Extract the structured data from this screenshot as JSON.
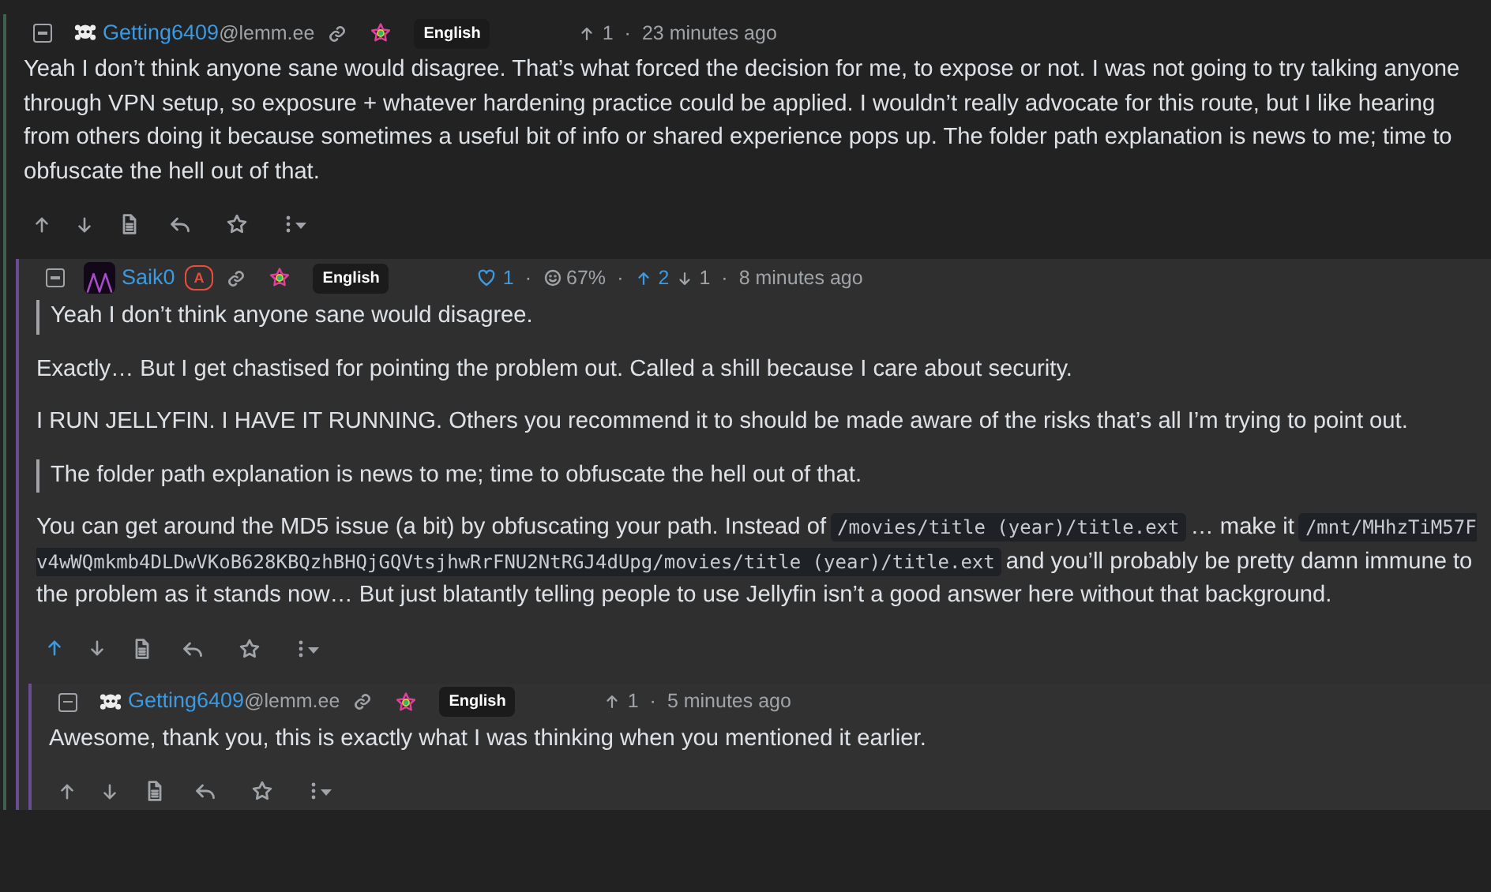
{
  "comments": [
    {
      "author": {
        "name": "Getting6409",
        "instance": "@lemm.ee",
        "avatar": {
          "kind": "skull"
        }
      },
      "language": "English",
      "stats": [
        {
          "kind": "up",
          "text": "1",
          "highlighted": false
        },
        {
          "kind": "dot",
          "text": "·",
          "highlighted": false
        },
        {
          "kind": "time",
          "text": "23 minutes ago",
          "highlighted": false
        }
      ],
      "body": [
        {
          "kind": "paragraph",
          "segments": [
            {
              "kind": "text",
              "text": "Yeah I don’t think anyone sane would disagree. That’s what forced the decision for me, to expose or not. I was not going to try talking anyone through VPN setup, so exposure + whatever hardening practice could be applied. I wouldn’t really advocate for this route, but I like hearing from others doing it because sometimes a useful bit of info or shared experience pops up. The folder path explanation is news to me; time to obfuscate the hell out of that."
            }
          ]
        }
      ],
      "upvoted": false,
      "children": [
        {
          "author": {
            "name": "Saik0",
            "avatar": {
              "kind": "image"
            },
            "admin_badge": "A"
          },
          "language": "English",
          "stats": [
            {
              "kind": "likes",
              "text": "1",
              "highlighted": true
            },
            {
              "kind": "dot",
              "text": "·",
              "highlighted": false
            },
            {
              "kind": "ratio",
              "text": "67%",
              "highlighted": false
            },
            {
              "kind": "dot",
              "text": "·",
              "highlighted": false
            },
            {
              "kind": "up",
              "text": "2",
              "highlighted": true
            },
            {
              "kind": "down",
              "text": "1",
              "highlighted": false
            },
            {
              "kind": "dot",
              "text": "·",
              "highlighted": false
            },
            {
              "kind": "time",
              "text": "8 minutes ago",
              "highlighted": false
            }
          ],
          "body": [
            {
              "kind": "quote",
              "segments": [
                {
                  "kind": "text",
                  "text": "Yeah I don’t think anyone sane would disagree."
                }
              ]
            },
            {
              "kind": "paragraph",
              "segments": [
                {
                  "kind": "text",
                  "text": "Exactly… But I get chastised for pointing the problem out. Called a shill because I care about security."
                }
              ]
            },
            {
              "kind": "paragraph",
              "segments": [
                {
                  "kind": "text",
                  "text": "I RUN JELLYFIN. I HAVE IT RUNNING. Others you recommend it to should be made aware of the risks that’s all I’m trying to point out."
                }
              ]
            },
            {
              "kind": "quote",
              "segments": [
                {
                  "kind": "text",
                  "text": "The folder path explanation is news to me; time to obfuscate the hell out of that."
                }
              ]
            },
            {
              "kind": "paragraph",
              "segments": [
                {
                  "kind": "text",
                  "text": "You can get around the MD5 issue (a bit) by obfuscating your path. Instead of"
                },
                {
                  "kind": "code",
                  "text": "/movies/title (year)/title.ext"
                },
                {
                  "kind": "text",
                  "text": "… make it"
                },
                {
                  "kind": "code",
                  "text": "/mnt/MHhzTiM57Fv4wWQmkmb4DLDwVKoB628KBQzhBHQjGQVtsjhwRrFNU2NtRGJ4dUpg/movies/title (year)/title.ext"
                },
                {
                  "kind": "text",
                  "text": "and you’ll probably be pretty damn immune to the problem as it stands now… But just blatantly telling people to use Jellyfin isn’t a good answer here without that background."
                }
              ]
            }
          ],
          "upvoted": true,
          "children": [
            {
              "author": {
                "name": "Getting6409",
                "instance": "@lemm.ee",
                "avatar": {
                  "kind": "skull"
                }
              },
              "language": "English",
              "stats": [
                {
                  "kind": "up",
                  "text": "1",
                  "highlighted": false
                },
                {
                  "kind": "dot",
                  "text": "·",
                  "highlighted": false
                },
                {
                  "kind": "time",
                  "text": "5 minutes ago",
                  "highlighted": false
                }
              ],
              "body": [
                {
                  "kind": "paragraph",
                  "segments": [
                    {
                      "kind": "text",
                      "text": "Awesome, thank you, this is exactly what I was thinking when you mentioned it earlier."
                    }
                  ]
                }
              ],
              "upvoted": false
            }
          ]
        }
      ]
    }
  ]
}
